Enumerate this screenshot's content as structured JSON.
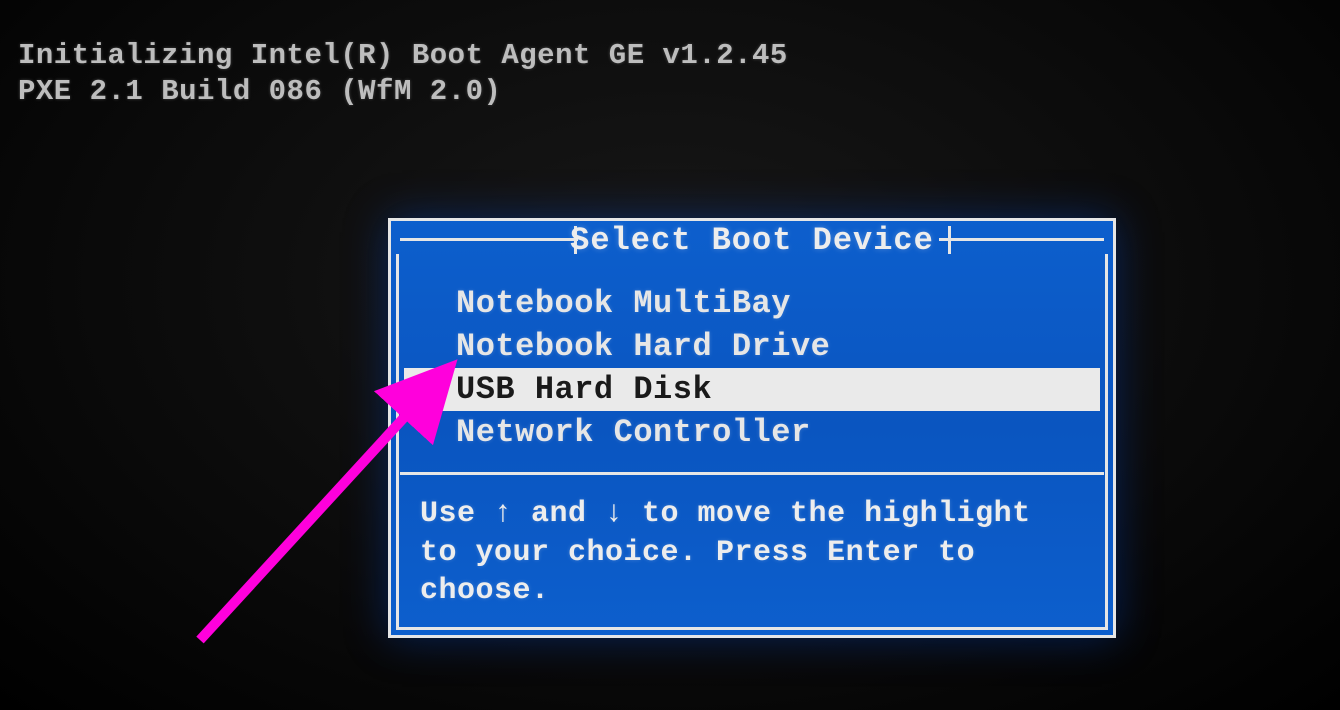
{
  "init": {
    "line1": "Initializing Intel(R) Boot Agent GE v1.2.45",
    "line2": "PXE 2.1 Build 086 (WfM 2.0)"
  },
  "dialog": {
    "title": "Select Boot Device",
    "items": [
      {
        "label": "Notebook MultiBay",
        "selected": false
      },
      {
        "label": "Notebook Hard Drive",
        "selected": false
      },
      {
        "label": "USB Hard Disk",
        "selected": true
      },
      {
        "label": "Network Controller",
        "selected": false
      }
    ],
    "help": "Use ↑ and ↓ to move the highlight to your choice.  Press Enter to choose."
  },
  "annotation": {
    "arrow_color": "#ff00dc"
  }
}
